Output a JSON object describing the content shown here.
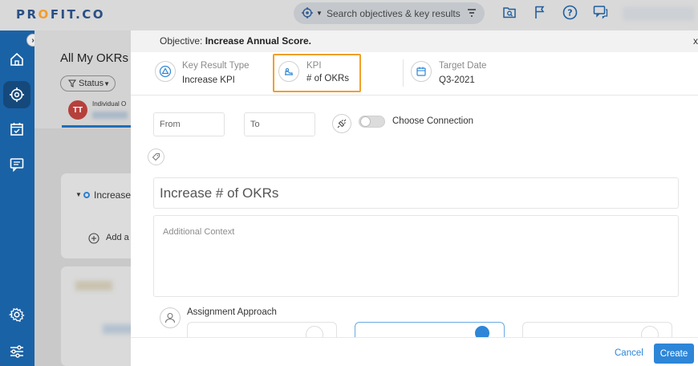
{
  "app": {
    "logo_text_1": "PR",
    "logo_o": "O",
    "logo_text_2": "FIT.CO"
  },
  "topbar": {
    "search_placeholder": "Search objectives & key results",
    "icons": [
      "target-icon",
      "filter-icon",
      "search-doc-icon",
      "flag-icon",
      "help-icon",
      "chat-icon"
    ]
  },
  "leftnav": {
    "items": [
      "home-icon",
      "target-icon",
      "calendar-check-icon",
      "message-icon",
      "settings-icon",
      "sliders-icon"
    ],
    "collapse_glyph": "›"
  },
  "background": {
    "page_title": "All My OKRs",
    "status_filter": "Status",
    "avatar_initials": "TT",
    "individual_label": "Individual O",
    "okr_row_text": "Increase",
    "add_text": "Add a"
  },
  "panel": {
    "objective_prefix": "Objective:",
    "objective_name": "Increase Annual Score.",
    "close_glyph": "x",
    "key_result_type_label": "Key Result Type",
    "key_result_type_value": "Increase KPI",
    "kpi_label": "KPI",
    "kpi_value": "# of OKRs",
    "target_date_label": "Target Date",
    "target_date_value": "Q3-2021",
    "from_placeholder": "From",
    "to_placeholder": "To",
    "connection_label": "Choose Connection",
    "connection_enabled": false,
    "title_value": "Increase # of OKRs",
    "context_placeholder": "Additional Context",
    "assignment_label": "Assignment Approach"
  },
  "footer": {
    "cancel_label": "Cancel",
    "create_label": "Create"
  },
  "colors": {
    "brand_blue": "#2a4f85",
    "brand_orange": "#f39c2c",
    "nav_blue": "#1a62a6",
    "accent": "#2d86d8",
    "highlight": "#f0a02b"
  }
}
